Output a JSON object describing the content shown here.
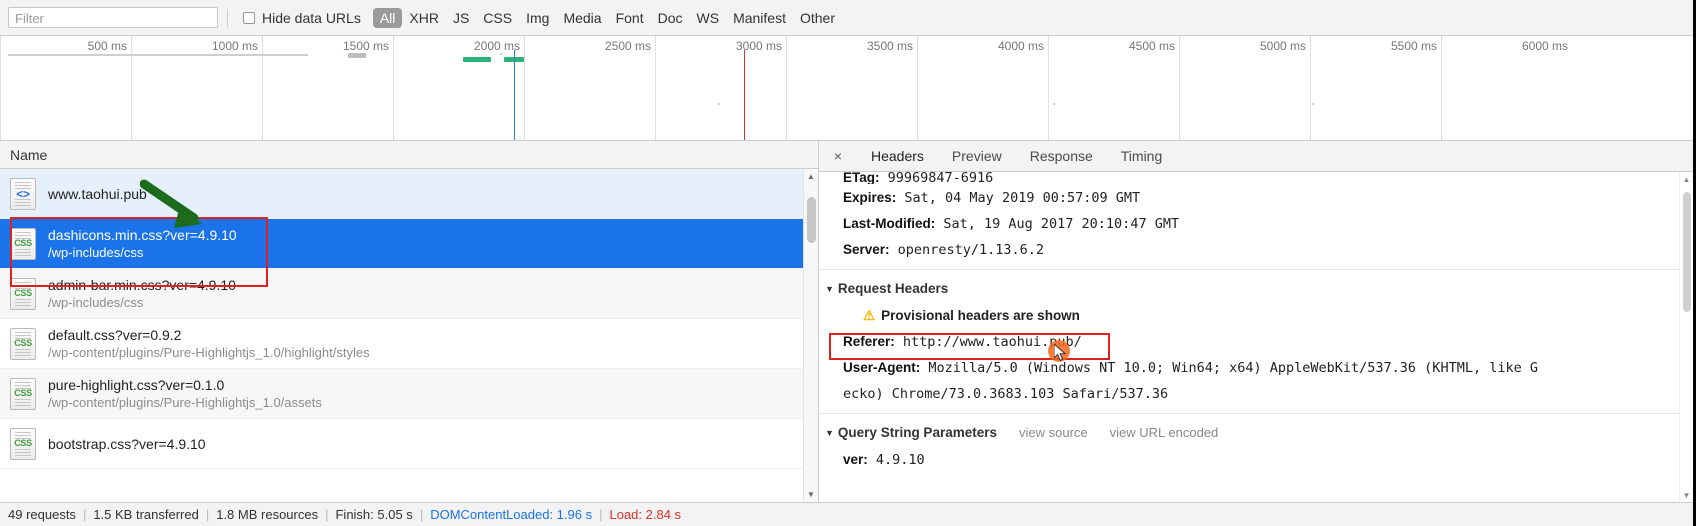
{
  "filter_bar": {
    "filter_placeholder": "Filter",
    "hide_data_urls_label": "Hide data URLs",
    "hide_data_urls_checked": false,
    "types": [
      {
        "label": "All",
        "active": true
      },
      {
        "label": "XHR",
        "active": false
      },
      {
        "label": "JS",
        "active": false
      },
      {
        "label": "CSS",
        "active": false
      },
      {
        "label": "Img",
        "active": false
      },
      {
        "label": "Media",
        "active": false
      },
      {
        "label": "Font",
        "active": false
      },
      {
        "label": "Doc",
        "active": false
      },
      {
        "label": "WS",
        "active": false
      },
      {
        "label": "Manifest",
        "active": false
      },
      {
        "label": "Other",
        "active": false
      }
    ]
  },
  "timeline": {
    "ticks": [
      "500 ms",
      "1000 ms",
      "1500 ms",
      "2000 ms",
      "2500 ms",
      "3000 ms",
      "3500 ms",
      "4000 ms",
      "4500 ms",
      "5000 ms",
      "5500 ms",
      "6000 ms"
    ],
    "dom_content_loaded_color": "#2a7fd4",
    "load_color": "#cc3333"
  },
  "request_table": {
    "column_header": "Name",
    "rows": [
      {
        "name": "www.taohui.pub",
        "path": "",
        "type": "doc",
        "icon_label": "<>",
        "state": "first"
      },
      {
        "name": "dashicons.min.css?ver=4.9.10",
        "path": "/wp-includes/css",
        "type": "css",
        "icon_label": "CSS",
        "state": "selected"
      },
      {
        "name": "admin-bar.min.css?ver=4.9.10",
        "path": "/wp-includes/css",
        "type": "css",
        "icon_label": "CSS",
        "state": "zebra"
      },
      {
        "name": "default.css?ver=0.9.2",
        "path": "/wp-content/plugins/Pure-Highlightjs_1.0/highlight/styles",
        "type": "css",
        "icon_label": "CSS",
        "state": "normal"
      },
      {
        "name": "pure-highlight.css?ver=0.1.0",
        "path": "/wp-content/plugins/Pure-Highlightjs_1.0/assets",
        "type": "css",
        "icon_label": "CSS",
        "state": "zebra"
      },
      {
        "name": "bootstrap.css?ver=4.9.10",
        "path": "",
        "type": "css",
        "icon_label": "CSS",
        "state": "normal"
      }
    ]
  },
  "status_bar": {
    "requests": "49 requests",
    "transferred": "1.5 KB transferred",
    "resources": "1.8 MB resources",
    "finish": "Finish: 5.05 s",
    "dom_content_loaded": "DOMContentLoaded: 1.96 s",
    "load": "Load: 2.84 s",
    "separator": "|"
  },
  "details": {
    "close_icon": "×",
    "tabs": [
      {
        "label": "Headers",
        "active": true
      },
      {
        "label": "Preview",
        "active": false
      },
      {
        "label": "Response",
        "active": false
      },
      {
        "label": "Timing",
        "active": false
      }
    ],
    "clipped_line": {
      "key": "ETag:",
      "value": " 99969847-6916"
    },
    "response_headers": [
      {
        "key": "Expires:",
        "value": " Sat, 04 May 2019 00:57:09 GMT"
      },
      {
        "key": "Last-Modified:",
        "value": " Sat, 19 Aug 2017 20:10:47 GMT"
      },
      {
        "key": "Server:",
        "value": " openresty/1.13.6.2"
      }
    ],
    "request_headers_section": {
      "caret": "▼",
      "title": "Request Headers",
      "warning_icon": "⚠",
      "warning_text": "Provisional headers are shown",
      "items": [
        {
          "key": "Referer:",
          "value": " http://www.taohui.pub/"
        },
        {
          "key": "User-Agent:",
          "value": " Mozilla/5.0 (Windows NT 10.0; Win64; x64) AppleWebKit/537.36 (KHTML, like G"
        },
        {
          "key": "",
          "value": "ecko) Chrome/73.0.3683.103 Safari/537.36"
        }
      ]
    },
    "query_string_section": {
      "caret": "▼",
      "title": "Query String Parameters",
      "view_source": "view source",
      "view_url_encoded": "view URL encoded",
      "params": [
        {
          "key": "ver:",
          "value": " 4.9.10"
        }
      ]
    }
  },
  "annotations": {
    "highlight_color": "#e02020",
    "arrow_color": "#1d6b1d",
    "cursor_color": "#f4681f"
  }
}
